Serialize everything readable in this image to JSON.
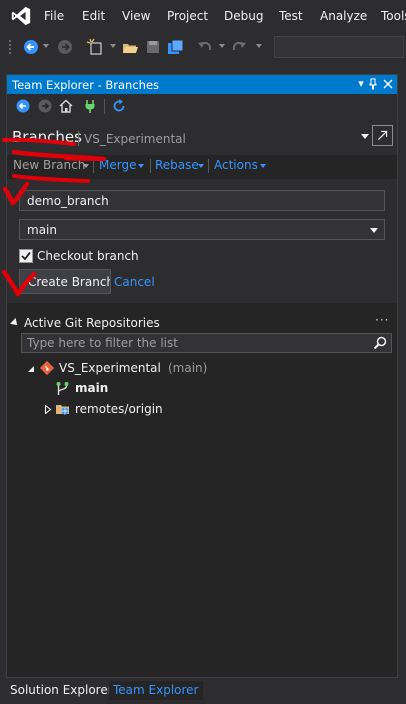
{
  "menu": {
    "items": [
      "File",
      "Edit",
      "View",
      "Project",
      "Debug",
      "Test",
      "Analyze",
      "Tools"
    ]
  },
  "tool_window": {
    "title": "Team Explorer - Branches",
    "pin_glyph": "📌",
    "close_glyph": "✕",
    "dropdown_glyph": "▾"
  },
  "header": {
    "title": "Branches",
    "context": "VS_Experimental"
  },
  "actions": {
    "new_branch": "New Branch",
    "merge": "Merge",
    "rebase": "Rebase",
    "actions": "Actions"
  },
  "new_branch_form": {
    "branch_name": "demo_branch",
    "base_branch": "main",
    "checkout_label": "Checkout branch",
    "checkout_checked": true,
    "create_label": "Create Branch",
    "cancel_label": "Cancel"
  },
  "repos": {
    "section_title": "Active Git Repositories",
    "more": "···",
    "filter_placeholder": "Type here to filter the list",
    "repo_name": "VS_Experimental",
    "repo_branch": "(main)",
    "branch_main": "main",
    "remotes": "remotes/origin"
  },
  "bottom_tabs": {
    "solution_explorer": "Solution Explorer",
    "team_explorer": "Team Explorer"
  },
  "colors": {
    "accent": "#007acc",
    "link": "#3794ff",
    "annotation": "#e0000a"
  },
  "icons": [
    "vs-logo-icon",
    "back-icon",
    "forward-icon",
    "new-project-icon",
    "open-folder-icon",
    "save-icon",
    "save-all-icon",
    "undo-icon",
    "redo-icon",
    "home-icon",
    "plug-icon",
    "refresh-icon",
    "popout-icon",
    "search-icon",
    "git-repo-icon",
    "branch-icon",
    "remote-folder-icon"
  ]
}
